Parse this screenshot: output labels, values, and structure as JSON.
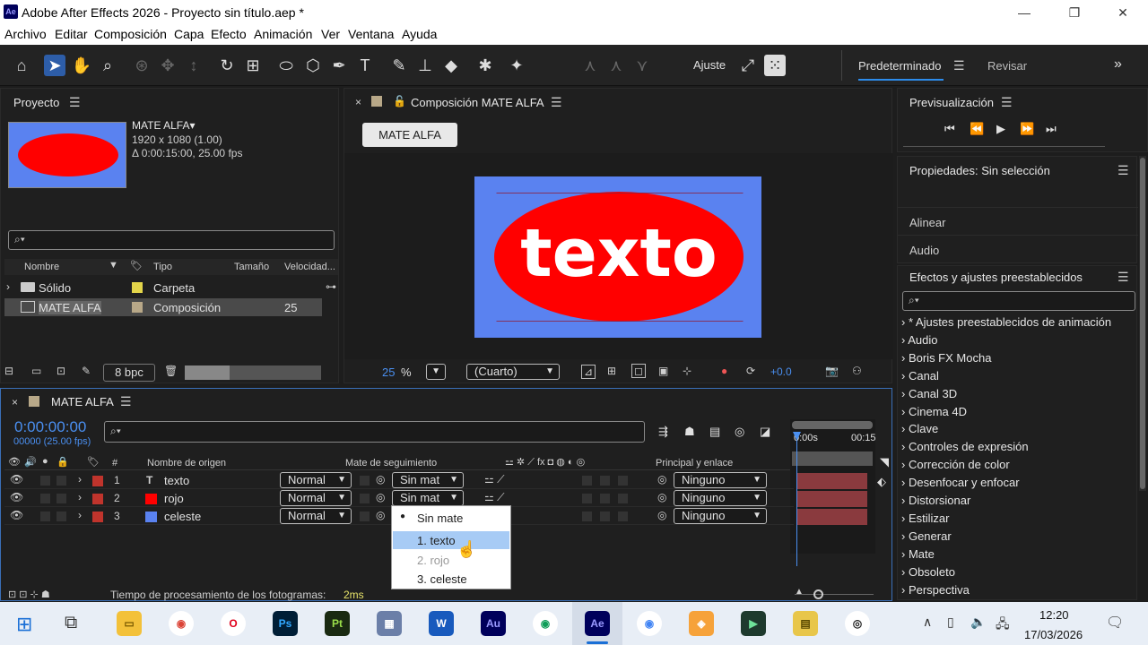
{
  "window": {
    "title": "Adobe After Effects 2026 - Proyecto sin título.aep *",
    "logo": "Ae",
    "minimize": "—",
    "restore": "❐",
    "close": "✕"
  },
  "menu": [
    "Archivo",
    "Editar",
    "Composición",
    "Capa",
    "Efecto",
    "Animación",
    "Ver",
    "Ventana",
    "Ayuda"
  ],
  "toolbar": {
    "ajuste": "Ajuste",
    "workspace_active": "Predeterminado",
    "workspace_other": "Revisar",
    "more": "»"
  },
  "project": {
    "title": "Proyecto",
    "comp_name": "MATE ALFA▾",
    "comp_size": "1920 x 1080 (1.00)",
    "comp_duration": "Δ 0:00:15:00, 25.00 fps",
    "headers": {
      "name": "Nombre",
      "type": "Tipo",
      "size": "Tamaño",
      "speed": "Velocidad..."
    },
    "rows": [
      {
        "name": "Sólido",
        "type": "Carpeta",
        "size": ""
      },
      {
        "name": "MATE ALFA",
        "type": "Composición",
        "size": "25"
      }
    ],
    "bpc": "8 bpc"
  },
  "composition": {
    "tab": "Composición MATE ALFA",
    "breadcrumb": "MATE ALFA",
    "canvas_text": "texto",
    "zoom": "25",
    "zoom_unit": "%",
    "resolution": "(Cuarto)",
    "exposure": "+0.0"
  },
  "preview": {
    "title": "Previsualización"
  },
  "properties": {
    "title": "Propiedades: Sin selección",
    "align": "Alinear",
    "audio": "Audio"
  },
  "effects": {
    "title": "Efectos y ajustes preestablecidos",
    "items": [
      "* Ajustes preestablecidos de animación",
      "Audio",
      "Boris FX Mocha",
      "Canal",
      "Canal 3D",
      "Cinema 4D",
      "Clave",
      "Controles de expresión",
      "Corrección de color",
      "Desenfocar y enfocar",
      "Distorsionar",
      "Estilizar",
      "Generar",
      "Mate",
      "Obsoleto",
      "Perspectiva"
    ]
  },
  "timeline": {
    "tab": "MATE ALFA",
    "timecode": "0:00:00:00",
    "frames": "00000 (25.00 fps)",
    "headers": {
      "num": "#",
      "source": "Nombre de origen",
      "track": "Mate de seguimiento",
      "parent": "Principal y enlace"
    },
    "ruler": [
      "0:00s",
      "00:15"
    ],
    "layers": [
      {
        "num": "1",
        "icon": "T",
        "name": "texto",
        "mode": "Normal",
        "matte": "Sin mat",
        "parent": "Ninguno",
        "color": "#c0342c"
      },
      {
        "num": "2",
        "icon": "",
        "name": "rojo",
        "mode": "Normal",
        "matte": "Sin mat",
        "parent": "Ninguno",
        "color": "#ff0000"
      },
      {
        "num": "3",
        "icon": "",
        "name": "celeste",
        "mode": "Normal",
        "matte": "",
        "parent": "Ninguno",
        "color": "#5a82f0"
      }
    ],
    "render_label": "Tiempo de procesamiento de los fotogramas:",
    "render_value": "2ms"
  },
  "matte_popup": {
    "options": [
      "Sin mate",
      "1. texto",
      "2. rojo",
      "3. celeste"
    ]
  },
  "taskbar": {
    "time": "12:20",
    "date": "17/03/2026",
    "apps": [
      {
        "label": "Ps",
        "color": "#001e36",
        "fg": "#31a8ff"
      },
      {
        "label": "Pt",
        "color": "#1a2a12",
        "fg": "#9adf4a"
      },
      {
        "label": "W",
        "color": "#185abd",
        "fg": "#ffffff"
      },
      {
        "label": "Au",
        "color": "#00005b",
        "fg": "#9999ff"
      },
      {
        "label": "Ae",
        "color": "#00005b",
        "fg": "#9999ff"
      }
    ]
  },
  "colors": {
    "accent": "#2d5da8",
    "comp_bg": "#5a82f0",
    "ellipse": "#ff0000",
    "timecode": "#4a8ff0"
  }
}
